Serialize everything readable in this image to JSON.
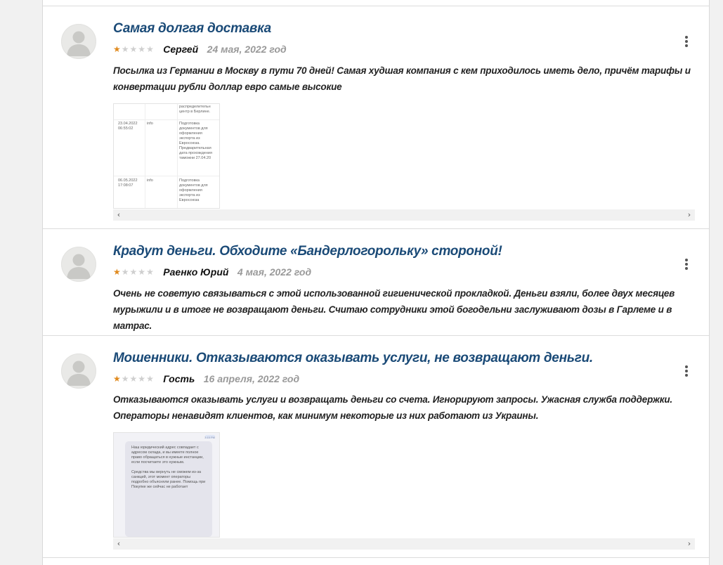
{
  "reviews": [
    {
      "title": "Самая долгая доставка",
      "rating": 1,
      "author": "Сергей",
      "date": "24 мая, 2022 год",
      "text": "Посылка из Германии в Москву в пути 70 дней! Самая худшая компания с кем приходилось иметь дело, причём тарифы и конвертации рубли доллар евро самые высокие",
      "attachment": {
        "rows": [
          {
            "date": "",
            "type": "",
            "status": "распределительн\nцентр в Берлине."
          },
          {
            "date": "23.04.2022\n06:55:02",
            "type": "info",
            "status": "Подготовка\nдокументов для\nоформления\nэкспорта из\nЕвросоюза.\nПредварительная\nдата прохождения\nтаможни 27.04.20"
          },
          {
            "date": "06.05.2022\n17:08:07",
            "type": "info",
            "status": "Подготовка\nдокументов для\nоформления\nэкспорта из\nЕвросоюза"
          }
        ]
      }
    },
    {
      "title": "Крадут деньги. Обходите «Бандерлогорольку» стороной!",
      "rating": 1,
      "author": "Раенко Юрий",
      "date": "4 мая, 2022 год",
      "text": "Очень не советую связываться с этой использованной гигиенической прокладкой. Деньги взяли, более двух месяцев мурыжили и в итоге не возвращают деньги. Считаю сотрудники этой богодельни заслуживают дозы в Гарлеме и в матрас."
    },
    {
      "title": "Мошенники. Отказываются оказывать услуги, не возвращают деньги.",
      "rating": 1,
      "author": "Гость",
      "date": "16 апреля, 2022 год",
      "text": "Отказываются оказывать услуги и возвращать деньги со счета. Игнорируют запросы. Ужасная служба поддержки. Операторы ненавидят клиентов, как минимум некоторые из них работают из Украины.",
      "attachment": {
        "time": "3:15 PM",
        "message": "Наш юридический адрес совпадает с адресом склада, и вы имеете полное право обращаться в нужные инстанции, если посчитаете это нужным.\n\nСредства мы вернуть не сможем из-за санкций, этот момент операторы подробно объясняли ранее. Помощь при Покупке же сейчас не работает"
      }
    }
  ],
  "icons": {
    "star": "★",
    "scroll_left": "‹",
    "scroll_right": "›",
    "menu": "more-vertical-icon"
  },
  "colors": {
    "title": "#1a4a77",
    "star_on": "#e08a1e",
    "star_off": "#cfcfcf",
    "date": "#999999"
  }
}
